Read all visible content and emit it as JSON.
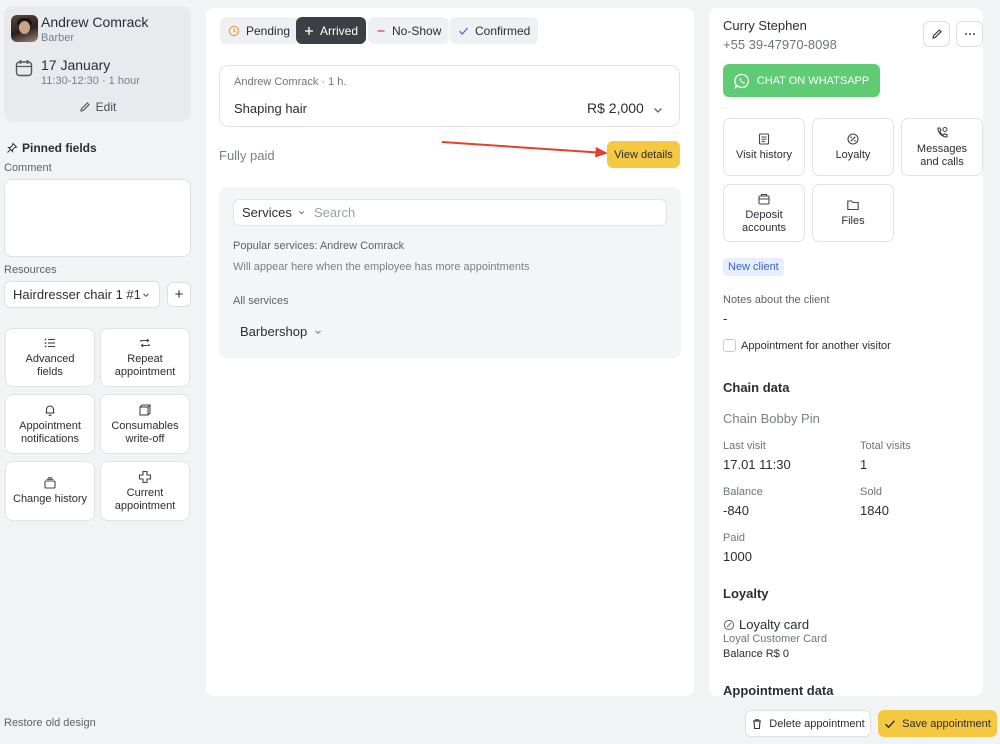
{
  "employee": {
    "name": "Andrew Comrack",
    "role": "Barber",
    "date": "17 January",
    "time": "11:30-12:30 · 1 hour",
    "edit_label": "Edit"
  },
  "left": {
    "pinned_label": "Pinned fields",
    "comment_label": "Comment",
    "comment_value": "",
    "resources_label": "Resources",
    "resource_value": "Hairdresser chair 1 #1",
    "add_resource": "+",
    "tiles": [
      {
        "label": "Advanced\nfields",
        "icon": "list-icon"
      },
      {
        "label": "Repeat\nappointment",
        "icon": "repeat-icon"
      },
      {
        "label": "Appointment\nnotifications",
        "icon": "bell-icon"
      },
      {
        "label": "Consumables\nwrite-off",
        "icon": "box-icon"
      },
      {
        "label": "Change history",
        "icon": "history-icon"
      },
      {
        "label": "Current\nappointment",
        "icon": "plus-cross-icon"
      }
    ],
    "restore_label": "Restore old design"
  },
  "statuses": {
    "pending": "Pending",
    "arrived": "Arrived",
    "no_show": "No-Show",
    "confirmed": "Confirmed",
    "active": "arrived"
  },
  "service": {
    "employee_line": "Andrew Comrack · 1 h.",
    "name": "Shaping hair",
    "price": "R$ 2,000"
  },
  "payment": {
    "status": "Fully paid",
    "view_details": "View details"
  },
  "services_panel": {
    "type_label": "Services",
    "search_placeholder": "Search",
    "popular_label": "Popular services: Andrew Comrack",
    "popular_hint": "Will appear here when the employee has more appointments",
    "all_label": "All services",
    "category": "Barbershop"
  },
  "client": {
    "name": "Curry Stephen",
    "phone": "+55 39-47970-8098",
    "whatsapp_label": "CHAT ON WHATSAPP",
    "tiles": [
      {
        "label": "Visit history",
        "icon": "history-doc-icon"
      },
      {
        "label": "Loyalty",
        "icon": "loyalty-icon"
      },
      {
        "label": "Messages\nand calls",
        "icon": "phone-icon"
      },
      {
        "label": "Deposit\naccounts",
        "icon": "wallet-icon"
      },
      {
        "label": "Files",
        "icon": "folder-icon"
      }
    ],
    "badge": "New client",
    "notes_label": "Notes about the client",
    "notes_value": "-",
    "other_visitor_label": "Appointment for another visitor"
  },
  "chain": {
    "title": "Chain data",
    "name": "Chain Bobby Pin",
    "last_visit_label": "Last visit",
    "last_visit": "17.01 11:30",
    "total_visits_label": "Total visits",
    "total_visits": "1",
    "balance_label": "Balance",
    "balance": "-840",
    "sold_label": "Sold",
    "sold": "1840",
    "paid_label": "Paid",
    "paid": "1000"
  },
  "loyalty": {
    "title": "Loyalty",
    "card_label": "Loyalty card",
    "card_name": "Loyal Customer Card",
    "balance": "Balance R$ 0"
  },
  "appointment_data_title": "Appointment data",
  "actions": {
    "delete": "Delete appointment",
    "save": "Save appointment"
  },
  "colors": {
    "accent_yellow": "#f5c842",
    "whatsapp_green": "#5fcb74",
    "arrow_red": "#e0412f",
    "badge_blue": "#3a62c9"
  }
}
